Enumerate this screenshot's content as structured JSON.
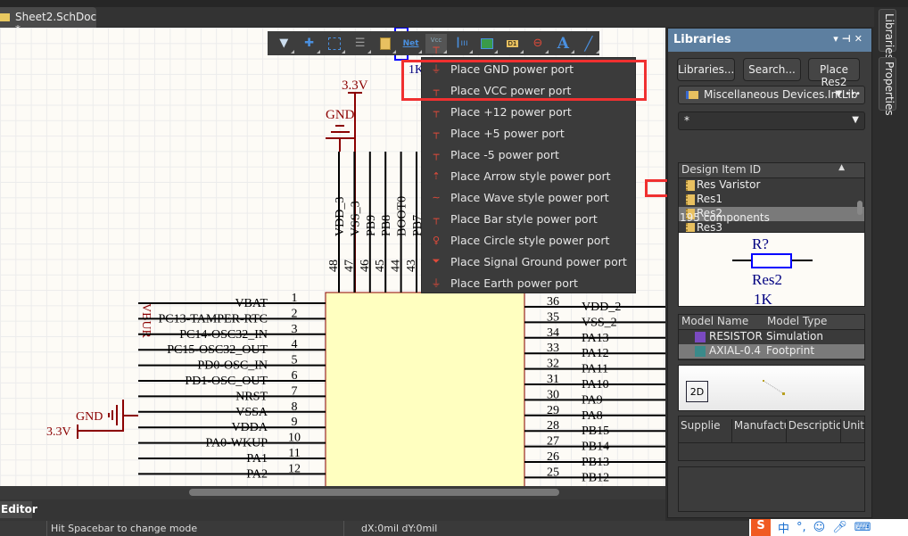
{
  "document_tab": {
    "title": "Sheet2.SchDoc *"
  },
  "toolbar": {
    "items": [
      "filter",
      "move",
      "select",
      "align",
      "component",
      "net-label",
      "power-port",
      "bus-entry",
      "sheet-symbol",
      "device-sheet",
      "port",
      "no-erc",
      "text",
      "line"
    ],
    "net_label": "Net",
    "vcc_label": "Vcc",
    "d1_label": "D1",
    "text_label": "A"
  },
  "power_menu": {
    "items": [
      {
        "label": "Place GND power port",
        "icon": "gnd"
      },
      {
        "label": "Place VCC power port",
        "icon": "Vcc"
      },
      {
        "label": "Place +12 power port",
        "icon": "+12"
      },
      {
        "label": "Place +5 power port",
        "icon": "+5"
      },
      {
        "label": "Place -5 power port",
        "icon": "-5"
      },
      {
        "label": "Place Arrow style power port",
        "icon": "arrow"
      },
      {
        "label": "Place Wave style power port",
        "icon": "wave"
      },
      {
        "label": "Place Bar style power port",
        "icon": "bar"
      },
      {
        "label": "Place Circle style power port",
        "icon": "circle"
      },
      {
        "label": "Place Signal Ground power port",
        "icon": "signal-ground"
      },
      {
        "label": "Place Earth power port",
        "icon": "earth"
      }
    ]
  },
  "schematic": {
    "power_top": "3.3V",
    "gnd_top": "GND",
    "resistor_value": "1K",
    "vbur_label": "VBUR",
    "gnd_left": "GND",
    "power_left": "3.3V",
    "top_pins": [
      {
        "num": "48",
        "name": "VDD_3"
      },
      {
        "num": "47",
        "name": "VSS_3"
      },
      {
        "num": "46",
        "name": "PB9"
      },
      {
        "num": "45",
        "name": "PB8"
      },
      {
        "num": "44",
        "name": "BOOT0"
      },
      {
        "num": "43",
        "name": "PB7"
      }
    ],
    "left_pins": [
      {
        "num": "1",
        "name": "VBAT"
      },
      {
        "num": "2",
        "name": "PC13-TAMPER-RTC"
      },
      {
        "num": "3",
        "name": "PC14-OSC32_IN"
      },
      {
        "num": "4",
        "name": "PC15-OSC32_OUT"
      },
      {
        "num": "5",
        "name": "PD0-OSC_IN"
      },
      {
        "num": "6",
        "name": "PD1-OSC_OUT"
      },
      {
        "num": "7",
        "name": "NRST"
      },
      {
        "num": "8",
        "name": "VSSA"
      },
      {
        "num": "9",
        "name": "VDDA"
      },
      {
        "num": "10",
        "name": "PA0-WKUP"
      },
      {
        "num": "11",
        "name": "PA1"
      },
      {
        "num": "12",
        "name": "PA2"
      }
    ],
    "right_pins": [
      {
        "num": "36",
        "name": "VDD_2"
      },
      {
        "num": "35",
        "name": "VSS_2"
      },
      {
        "num": "34",
        "name": "PA13"
      },
      {
        "num": "33",
        "name": "PA12"
      },
      {
        "num": "32",
        "name": "PA11"
      },
      {
        "num": "31",
        "name": "PA10"
      },
      {
        "num": "30",
        "name": "PA9"
      },
      {
        "num": "29",
        "name": "PA8"
      },
      {
        "num": "28",
        "name": "PB15"
      },
      {
        "num": "27",
        "name": "PB14"
      },
      {
        "num": "26",
        "name": "PB13"
      },
      {
        "num": "25",
        "name": "PB12"
      }
    ]
  },
  "libraries_panel": {
    "title": "Libraries",
    "libraries_button": "Libraries...",
    "search_button": "Search...",
    "place_button": "Place Res2",
    "library": "Miscellaneous Devices.IntLib",
    "more": "•••",
    "filter": "*",
    "column_header": "Design Item ID",
    "items": [
      "Res Varistor",
      "Res1",
      "Res2",
      "Res3"
    ],
    "selected_item": "Res2",
    "count": "195 components",
    "preview": {
      "designator": "R?",
      "comment": "Res2",
      "value": "1K"
    },
    "models": {
      "headers": [
        "Model Name",
        "Model Type"
      ],
      "rows": [
        {
          "name": "RESISTOR",
          "type": "Simulation"
        },
        {
          "name": "AXIAL-0.4",
          "type": "Footprint"
        }
      ]
    },
    "view_2d": "2D",
    "supplier_headers": [
      "Supplie",
      "Manufactu",
      "Descriptior",
      "Unit"
    ]
  },
  "side_tabs": [
    "Libraries",
    "Properties"
  ],
  "bottom": {
    "editor_tab": "Editor"
  },
  "status": {
    "hint": "Hit Spacebar to change mode",
    "delta": "dX:0mil dY:0mil"
  },
  "ime": {
    "logo": "S",
    "lang": "中"
  },
  "colors": {
    "accent_red": "#f03030",
    "wire_red": "#8b0000",
    "chip_fill": "#ffffc0",
    "panel_header": "#5d7fa0"
  }
}
